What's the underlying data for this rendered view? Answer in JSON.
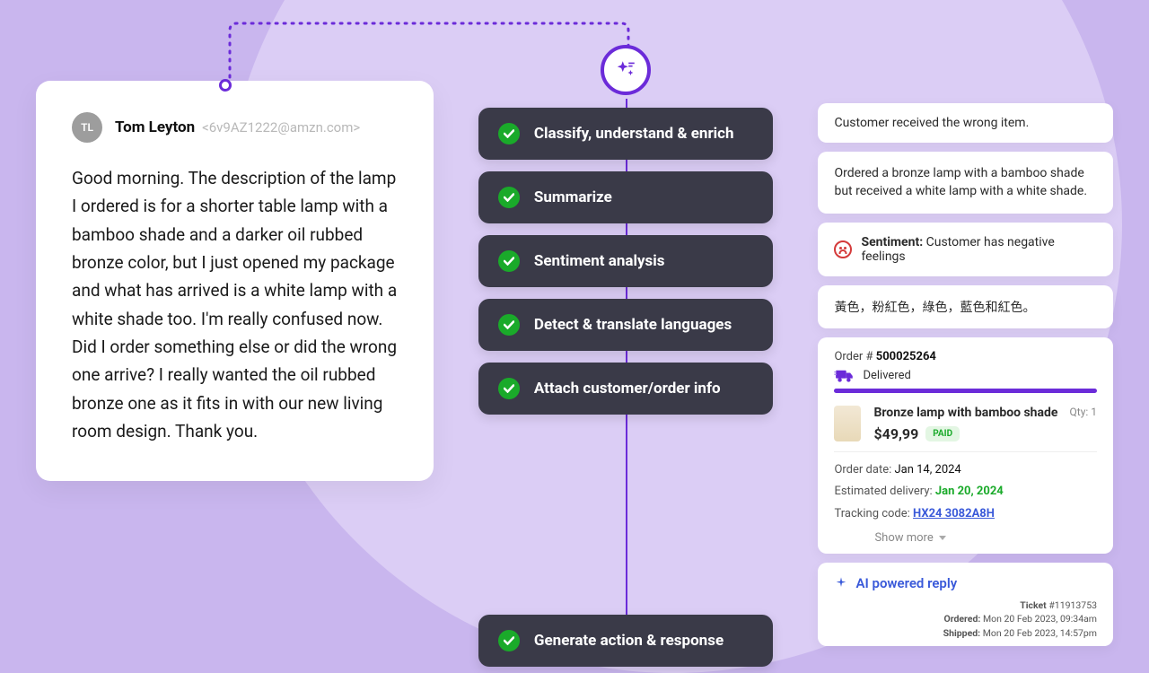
{
  "email": {
    "avatar_initials": "TL",
    "sender_name": "Tom Leyton",
    "sender_email": "<6v9AZ1222@amzn.com>",
    "body": "Good morning. The description of the lamp I ordered is for a shorter table lamp with a bamboo shade and a darker oil rubbed bronze color, but I just opened my package and what has arrived is a white lamp with a white shade too. I'm really confused now. Did I order something else or did the wrong one arrive? I really wanted the oil rubbed bronze one as it fits in with our new living room design. Thank you."
  },
  "steps": {
    "classify": "Classify, understand & enrich",
    "summarize": "Summarize",
    "sentiment": "Sentiment analysis",
    "translate": "Detect & translate languages",
    "attach": "Attach customer/order info",
    "generate": "Generate action & response"
  },
  "outputs": {
    "classify": "Customer received the wrong item.",
    "summarize": "Ordered a bronze lamp with a bamboo shade but received a white lamp with a white shade.",
    "sentiment_label": "Sentiment:",
    "sentiment_text": " Customer has negative feelings",
    "translate": "黃色，粉紅色，綠色，藍色和紅色。"
  },
  "order": {
    "label": "Order # ",
    "number": "500025264",
    "status": "Delivered",
    "item_name": "Bronze lamp with bamboo shade",
    "qty_label": "Qty: ",
    "qty": "1",
    "price": "$49,99",
    "paid": "PAID",
    "date_label": "Order date: ",
    "date": "Jan 14, 2024",
    "est_label": "Estimated delivery: ",
    "est": "Jan 20, 2024",
    "track_label": "Tracking code: ",
    "track": "HX24 3082A8H",
    "show_more": "Show more"
  },
  "reply": {
    "title": "AI powered reply",
    "ticket_label": "Ticket ",
    "ticket": "#11913753",
    "ordered_label": "Ordered: ",
    "ordered": "Mon 20 Feb 2023, 09:34am",
    "shipped_label": "Shipped: ",
    "shipped": "Mon 20 Feb 2023, 14:57pm"
  }
}
